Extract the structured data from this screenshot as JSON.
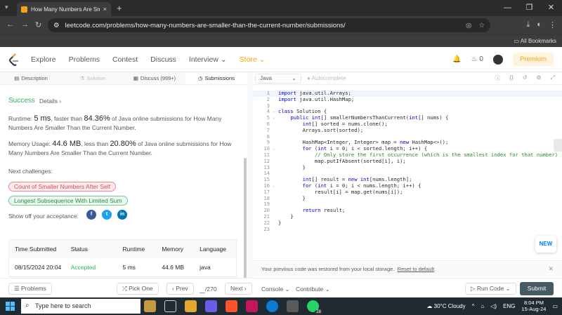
{
  "browser": {
    "tab_title": "How Many Numbers Are Smaller",
    "tab_close": "×",
    "new_tab": "+",
    "url": "leetcode.com/problems/how-many-numbers-are-smaller-than-the-current-number/submissions/",
    "all_bookmarks": "All Bookmarks",
    "window_controls": [
      "—",
      "❐",
      "✕"
    ]
  },
  "lc_header": {
    "menu": [
      "Explore",
      "Problems",
      "Contest",
      "Discuss",
      "Interview ⌄",
      "Store ⌄"
    ],
    "streak": "0",
    "premium": "Premium"
  },
  "left_tabs": [
    "Description",
    "Solution",
    "Discuss (999+)",
    "Submissions"
  ],
  "result": {
    "status": "Success",
    "details": "Details ›",
    "runtime_prefix": "Runtime: ",
    "runtime": "5 ms",
    "runtime_mid": ", faster than ",
    "runtime_pct": "84.36%",
    "runtime_suffix": " of Java online submissions for How Many Numbers Are Smaller Than the Current Number.",
    "memory_prefix": "Memory Usage: ",
    "memory": "44.6 MB",
    "memory_mid": ", less than ",
    "memory_pct": "20.80%",
    "memory_suffix": " of Java online submissions for How Many Numbers Are Smaller Than the Current Number.",
    "next_challenges": "Next challenges:",
    "challenge1": "Count of Smaller Numbers After Self",
    "challenge2": "Longest Subsequence With Limited Sum",
    "share": "Show off your acceptance:",
    "social": [
      "f",
      "t",
      "in"
    ]
  },
  "table": {
    "headers": [
      "Time Submitted",
      "Status",
      "Runtime",
      "Memory",
      "Language"
    ],
    "row": [
      "08/15/2024 20:04",
      "Accepted",
      "5 ms",
      "44.6 MB",
      "java"
    ]
  },
  "editor": {
    "language": "Java",
    "autocomplete": "Autocomplete",
    "new_badge": "NEW",
    "restored_msg": "Your previous code was restored from your local storage.",
    "reset_link": "Reset to default",
    "lines": [
      "import java.util.Arrays;",
      "import java.util.HashMap;",
      "",
      "class Solution {",
      "    public int[] smallerNumbersThanCurrent(int[] nums) {",
      "        int[] sorted = nums.clone();",
      "        Arrays.sort(sorted);",
      "",
      "        HashMap<Integer, Integer> map = new HashMap<>();",
      "        for (int i = 0; i < sorted.length; i++) {",
      "            // Only store the first occurrence (which is the smallest index for that number)",
      "            map.putIfAbsent(sorted[i], i);",
      "        }",
      "",
      "        int[] result = new int[nums.length];",
      "        for (int i = 0; i < nums.length; i++) {",
      "            result[i] = map.get(nums[i]);",
      "        }",
      "",
      "        return result;",
      "    }",
      "}",
      ""
    ]
  },
  "footer": {
    "problems": "☰ Problems",
    "pick_one": "⤮ Pick One",
    "prev": "‹ Prev",
    "page": "/270",
    "next": "Next ›",
    "console": "Console ⌄",
    "contribute": "Contribute ⌄",
    "run_code": "▷ Run Code ⌄",
    "submit": "Submit"
  },
  "taskbar": {
    "search": "Type here to search",
    "weather": "30°C  Cloudy",
    "lang": "ENG",
    "time": "8:04 PM",
    "date": "15-Aug-24",
    "badge": "28"
  }
}
